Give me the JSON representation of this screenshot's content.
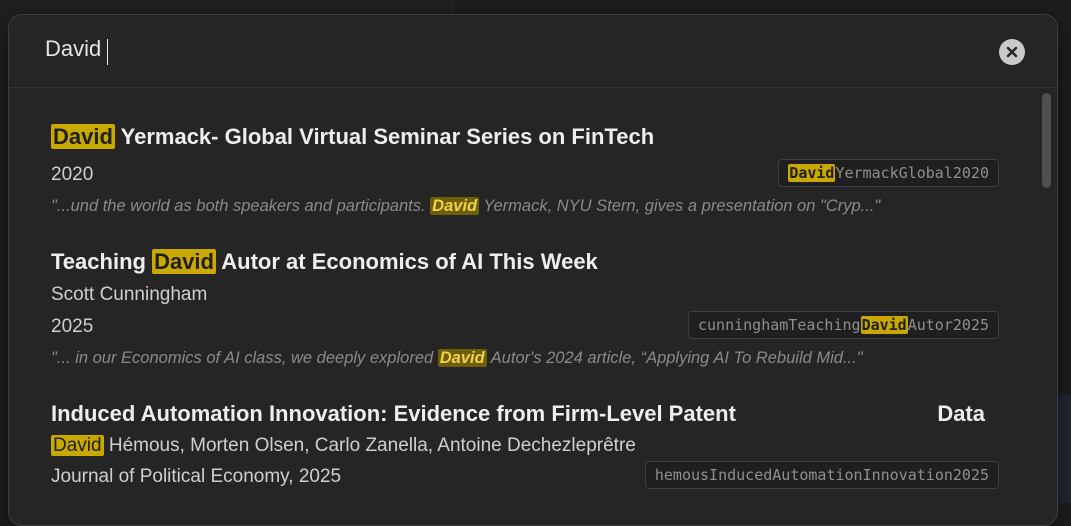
{
  "search": {
    "query": "David"
  },
  "results": [
    {
      "title_hl": "David",
      "title_rest": " Yermack- Global Virtual Seminar Series on FinTech",
      "year": "2020",
      "citekey_hl": "David",
      "citekey_rest": "YermackGlobal2020",
      "excerpt_pre": "\"...und the world as both speakers and participants. ",
      "excerpt_hl": "David",
      "excerpt_post": " Yermack, NYU Stern, gives a presentation on \"Cryp...\""
    },
    {
      "title_pre": "Teaching ",
      "title_hl": "David",
      "title_post": " Autor at Economics of AI This Week",
      "author": "Scott Cunningham",
      "year": "2025",
      "citekey_pre": "cunninghamTeaching",
      "citekey_hl": "David",
      "citekey_post": "Autor2025",
      "excerpt_pre": "\"... in our Economics of AI class, we deeply explored ",
      "excerpt_hl": "David",
      "excerpt_post": " Autor's 2024 article, “Applying AI To Rebuild Mid...\""
    },
    {
      "title": "Induced Automation Innovation: Evidence from Firm-Level Patent",
      "title_tail": "Data",
      "authors_hl": "David",
      "authors_rest": " Hémous, Morten Olsen, Carlo Zanella, Antoine Dechezleprêtre",
      "venue": "Journal of Political Economy, 2025",
      "citekey": "hemousInducedAutomationInnovation2025"
    }
  ],
  "colors": {
    "highlight": "#c9a800",
    "background": "#252525"
  }
}
